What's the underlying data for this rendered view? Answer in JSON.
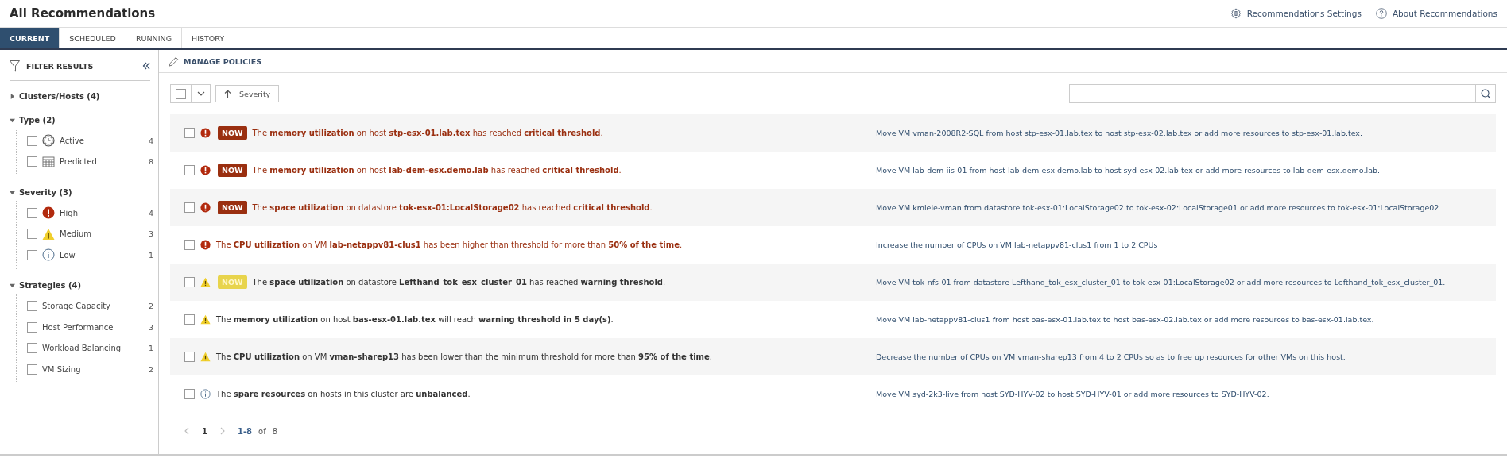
{
  "title": "All Recommendations",
  "header_links": [
    {
      "kind": "settings",
      "label": "Recommendations Settings"
    },
    {
      "kind": "help",
      "label": "About Recommendations"
    }
  ],
  "tabs": [
    {
      "label": "CURRENT",
      "selected": true
    },
    {
      "label": "SCHEDULED",
      "selected": false
    },
    {
      "label": "RUNNING",
      "selected": false
    },
    {
      "label": "HISTORY",
      "selected": false
    }
  ],
  "filter": {
    "title": "FILTER RESULTS",
    "groups": [
      {
        "label": "Clusters/Hosts (4)",
        "expanded": false
      },
      {
        "label": "Type (2)",
        "expanded": true,
        "items": [
          {
            "label": "Active",
            "count": "4",
            "kind": "clock",
            "checked": false
          },
          {
            "label": "Predicted",
            "count": "8",
            "kind": "calendar",
            "checked": false
          }
        ]
      },
      {
        "label": "Severity (3)",
        "expanded": true,
        "items": [
          {
            "label": "High",
            "count": "4",
            "kind": "high",
            "checked": false
          },
          {
            "label": "Medium",
            "count": "3",
            "kind": "medium",
            "checked": false
          },
          {
            "label": "Low",
            "count": "1",
            "kind": "low",
            "checked": false
          }
        ]
      },
      {
        "label": "Strategies (4)",
        "expanded": true,
        "items": [
          {
            "label": "Storage Capacity",
            "count": "2",
            "checked": false
          },
          {
            "label": "Host Performance",
            "count": "3",
            "checked": false
          },
          {
            "label": "Workload Balancing",
            "count": "1",
            "checked": false
          },
          {
            "label": "VM Sizing",
            "count": "2",
            "checked": false
          }
        ]
      }
    ]
  },
  "manage_policies": "MANAGE POLICIES",
  "toolbar": {
    "select_all_checked": false,
    "sort_label": "Severity"
  },
  "rows": [
    {
      "kind": "high",
      "badge": "NOW",
      "checked": false,
      "message": "The **memory utilization** on host **stp-esx-01.lab.tex** has reached **critical threshold**.",
      "action": "Move VM vman-2008R2-SQL from host stp-esx-01.lab.tex to host stp-esx-02.lab.tex or add more resources to stp-esx-01.lab.tex."
    },
    {
      "kind": "high",
      "badge": "NOW",
      "checked": false,
      "message": "The **memory utilization** on host **lab-dem-esx.demo.lab** has reached **critical threshold**.",
      "action": "Move VM lab-dem-iis-01 from host lab-dem-esx.demo.lab to host syd-esx-02.lab.tex or add more resources to lab-dem-esx.demo.lab."
    },
    {
      "kind": "high",
      "badge": "NOW",
      "checked": false,
      "message": "The **space utilization** on datastore **tok-esx-01:LocalStorage02** has reached **critical threshold**.",
      "action": "Move VM kmiele-vman from datastore tok-esx-01:LocalStorage02 to tok-esx-02:LocalStorage01 or add more resources to tok-esx-01:LocalStorage02."
    },
    {
      "kind": "high",
      "checked": false,
      "message": "The **CPU utilization** on VM **lab-netappv81-clus1** has been higher than threshold for more than **50% of the time**.",
      "action": "Increase the number of CPUs on VM lab-netappv81-clus1 from 1 to 2 CPUs"
    },
    {
      "kind": "medium",
      "badge": "NOW",
      "checked": false,
      "message": "The **space utilization** on datastore **Lefthand_tok_esx_cluster_01** has reached **warning threshold**.",
      "action": "Move VM tok-nfs-01 from datastore Lefthand_tok_esx_cluster_01 to tok-esx-01:LocalStorage02 or add more resources to Lefthand_tok_esx_cluster_01."
    },
    {
      "kind": "medium",
      "checked": false,
      "message": "The **memory utilization** on host **bas-esx-01.lab.tex** will reach **warning threshold in 5 day(s)**.",
      "action": "Move VM lab-netappv81-clus1 from host bas-esx-01.lab.tex to host bas-esx-02.lab.tex or add more resources to bas-esx-01.lab.tex."
    },
    {
      "kind": "medium",
      "checked": false,
      "message": "The **CPU utilization** on VM **vman-sharep13** has been lower than the minimum threshold for more than **95% of the time**.",
      "action": "Decrease the number of CPUs on VM vman-sharep13 from 4 to 2 CPUs so as to free up resources for other VMs on this host."
    },
    {
      "kind": "low",
      "checked": false,
      "message": "The **spare resources** on hosts in this cluster are **unbalanced**.",
      "action": "Move VM syd-2k3-live from host SYD-HYV-02 to host SYD-HYV-01 or add more resources to SYD-HYV-02."
    }
  ],
  "pagination": {
    "page": "1",
    "range": "1-8",
    "of": "of",
    "total": "8"
  }
}
